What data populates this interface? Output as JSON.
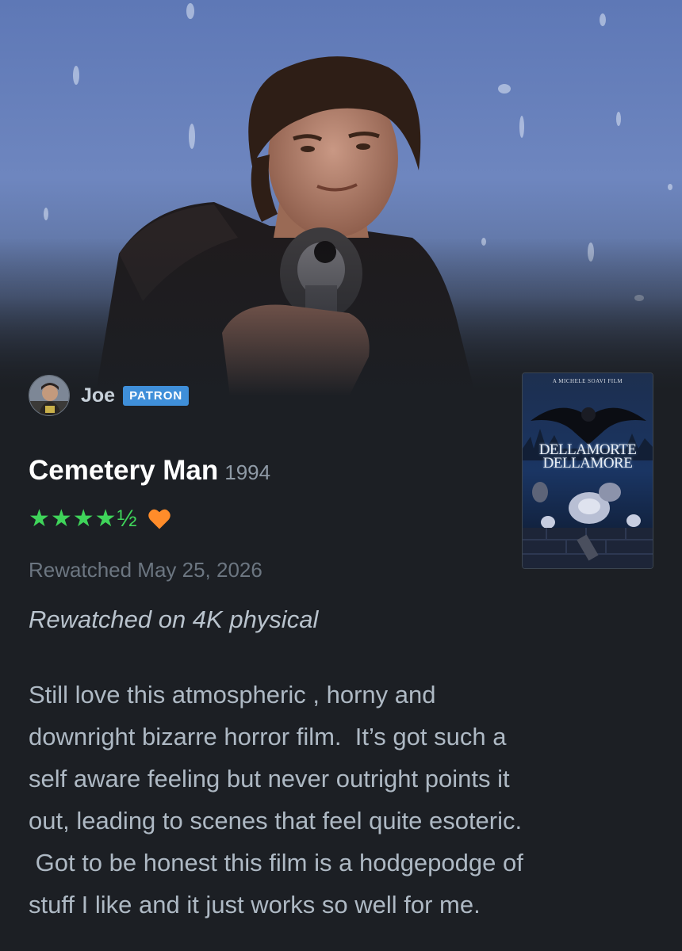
{
  "reviewer": {
    "name": "Joe",
    "badge": "PATRON",
    "avatar_icon": "user-avatar"
  },
  "film": {
    "title": "Cemetery Man",
    "year": "1994",
    "poster": {
      "credit": "A MICHELE SOAVI FILM",
      "title_line1": "DELLAMORTE",
      "title_line2": "DELLAMORE"
    }
  },
  "rating": {
    "stars": 4.5,
    "stars_text": "★★★★½",
    "liked": true,
    "star_color": "#3fd45a",
    "heart_color": "#ff8c2a"
  },
  "watched_text": "Rewatched May 25, 2026",
  "tagline": "Rewatched on 4K physical",
  "review": {
    "lines": [
      "Still love this atmospheric , horny and",
      "downright bizarre horror film.  It’s got such a",
      "self aware feeling but never outright points it",
      "out, leading to scenes that feel quite esoteric.",
      " Got to be honest this film is a hodgepodge of",
      "stuff I like and it just works so well for me."
    ]
  },
  "colors": {
    "background": "#1c1f24",
    "badge": "#3f8fd9",
    "title": "#ffffff",
    "muted": "#6c7681",
    "body_text": "#aeb9c4"
  }
}
